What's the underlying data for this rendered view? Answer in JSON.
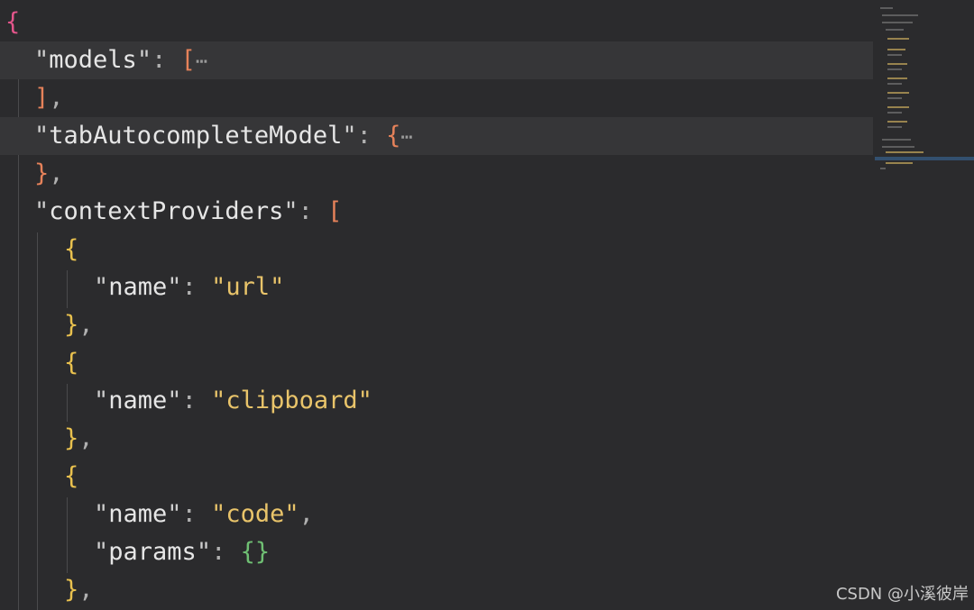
{
  "editor": {
    "lines": [
      {
        "l1": "{"
      },
      {
        "q1": "\"",
        "key": "models",
        "q2": "\"",
        "colon": ": ",
        "open": "[",
        "fold": "⋯"
      },
      {
        "close": "]",
        "comma": ","
      },
      {
        "q1": "\"",
        "key": "tabAutocompleteModel",
        "q2": "\"",
        "colon": ": ",
        "open": "{",
        "fold": "⋯"
      },
      {
        "close": "}",
        "comma": ","
      },
      {
        "q1": "\"",
        "key": "contextProviders",
        "q2": "\"",
        "colon": ": ",
        "open": "["
      },
      {
        "open": "{"
      },
      {
        "q1": "\"",
        "key": "name",
        "q2": "\"",
        "colon": ": ",
        "value": "\"url\""
      },
      {
        "close": "}",
        "comma": ","
      },
      {
        "open": "{"
      },
      {
        "q1": "\"",
        "key": "name",
        "q2": "\"",
        "colon": ": ",
        "value": "\"clipboard\""
      },
      {
        "close": "}",
        "comma": ","
      },
      {
        "open": "{"
      },
      {
        "q1": "\"",
        "key": "name",
        "q2": "\"",
        "colon": ": ",
        "value": "\"code\"",
        "comma": ","
      },
      {
        "q1": "\"",
        "key": "params",
        "q2": "\"",
        "colon": ": ",
        "obj": "{}"
      },
      {
        "close": "}",
        "comma": ","
      }
    ]
  },
  "colors": {
    "background": "#2b2b2d",
    "folded_line": "#363638",
    "root_brace": "#e4558b",
    "bracket": "#e6825a",
    "object_brace": "#e9c14e",
    "inner_brace": "#6fbf73",
    "string": "#e9c46a"
  },
  "watermark": "CSDN @小溪彼岸"
}
